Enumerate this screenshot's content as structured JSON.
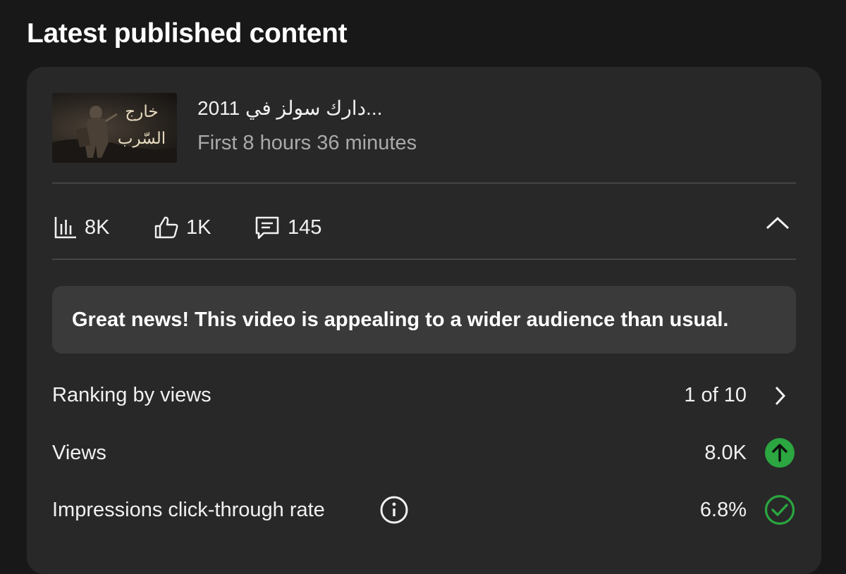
{
  "section": {
    "heading": "Latest published content"
  },
  "video": {
    "thumbnail_text_line1": "خارج",
    "thumbnail_text_line2": "السّرب",
    "title": "دارك سولز في 2011...",
    "subtitle": "First 8 hours 36 minutes"
  },
  "stats": {
    "views": "8K",
    "likes": "1K",
    "comments": "145"
  },
  "banner": {
    "message": "Great news! This video is appealing to a wider audience than usual."
  },
  "metrics": [
    {
      "label": "Ranking by views",
      "value": "1 of 10",
      "icon": "chevron-right-icon"
    },
    {
      "label": "Views",
      "value": "8.0K",
      "icon": "arrow-up-circle-icon"
    },
    {
      "label": "Impressions click-through rate",
      "value": "6.8%",
      "icon": "check-circle-icon"
    }
  ],
  "colors": {
    "background": "#181818",
    "card": "#282828",
    "banner": "#3a3a3a",
    "positive": "#2ba640",
    "secondary_text": "#aaaaaa"
  }
}
